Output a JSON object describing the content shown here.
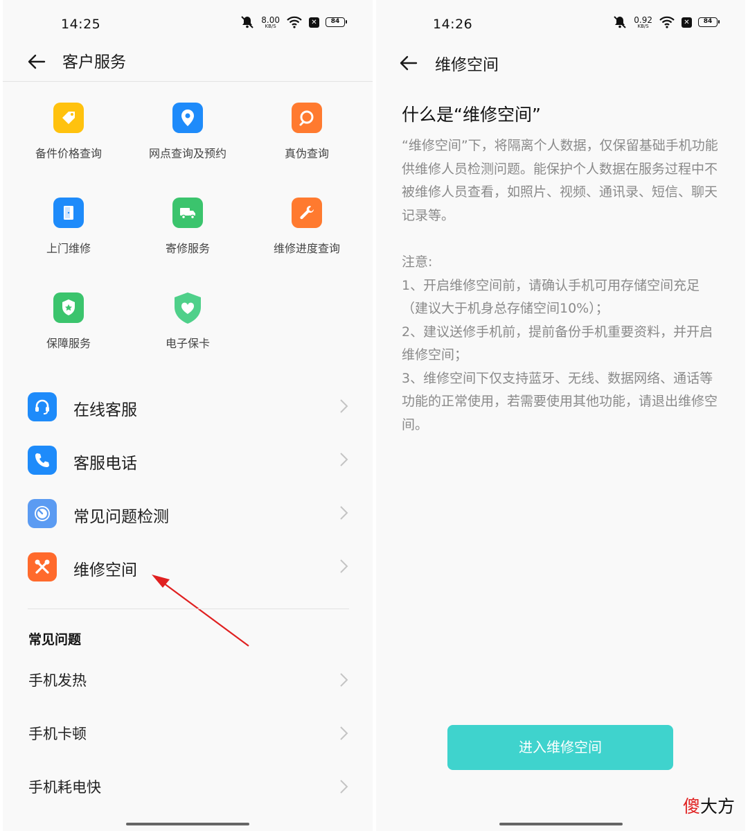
{
  "left": {
    "status": {
      "time": "14:25",
      "speed_value": "8.00",
      "speed_unit": "KB/S",
      "battery": "84"
    },
    "header": {
      "title": "客户服务"
    },
    "grid": [
      {
        "label": "备件价格查询",
        "icon": "price-tag-icon",
        "color": "#ffc20e"
      },
      {
        "label": "网点查询及预约",
        "icon": "location-pin-icon",
        "color": "#1e8bfa"
      },
      {
        "label": "真伪查询",
        "icon": "magnifier-icon",
        "color": "#ff7a2f"
      },
      {
        "label": "上门维修",
        "icon": "door-icon",
        "color": "#1e8bfa"
      },
      {
        "label": "寄修服务",
        "icon": "truck-icon",
        "color": "#3bc46d"
      },
      {
        "label": "维修进度查询",
        "icon": "wrench-icon",
        "color": "#ff7a2f"
      },
      {
        "label": "保障服务",
        "icon": "shield-icon",
        "color": "#3bc46d"
      },
      {
        "label": "电子保卡",
        "icon": "heart-shield-icon",
        "color": "#4fd08a"
      }
    ],
    "list": [
      {
        "label": "在线客服",
        "icon": "headset-icon",
        "color": "#1e8bfa"
      },
      {
        "label": "客服电话",
        "icon": "phone-icon",
        "color": "#1e8bfa"
      },
      {
        "label": "常见问题检测",
        "icon": "gauge-icon",
        "color": "#5b9bf2"
      },
      {
        "label": "维修空间",
        "icon": "tools-icon",
        "color": "#ff6a2c"
      }
    ],
    "faq": {
      "title": "常见问题",
      "items": [
        "手机发热",
        "手机卡顿",
        "手机耗电快"
      ]
    }
  },
  "right": {
    "status": {
      "time": "14:26",
      "speed_value": "0.92",
      "speed_unit": "KB/S",
      "battery": "84"
    },
    "header": {
      "title": "维修空间"
    },
    "heading": "什么是“维修空间”",
    "intro": "“维修空间”下，将隔离个人数据，仅保留基础手机功能供维修人员检测问题。能保护个人数据在服务过程中不被维修人员查看，如照片、视频、通讯录、短信、聊天记录等。",
    "notes_title": "注意:",
    "notes": [
      "1、开启维修空间前，请确认手机可用存储空间充足（建议大于机身总存储空间10%）；",
      "2、建议送修手机前，提前备份手机重要资料，并开启维修空间；",
      "3、维修空间下仅支持蓝牙、无线、数据网络、通话等功能的正常使用，若需要使用其他功能，请退出维修空间。"
    ],
    "button": "进入维修空间"
  },
  "watermark": {
    "red": "傻",
    "black": "大方"
  },
  "colors": {
    "accent_button": "#3fd3cd",
    "arrow": "#e02020"
  }
}
